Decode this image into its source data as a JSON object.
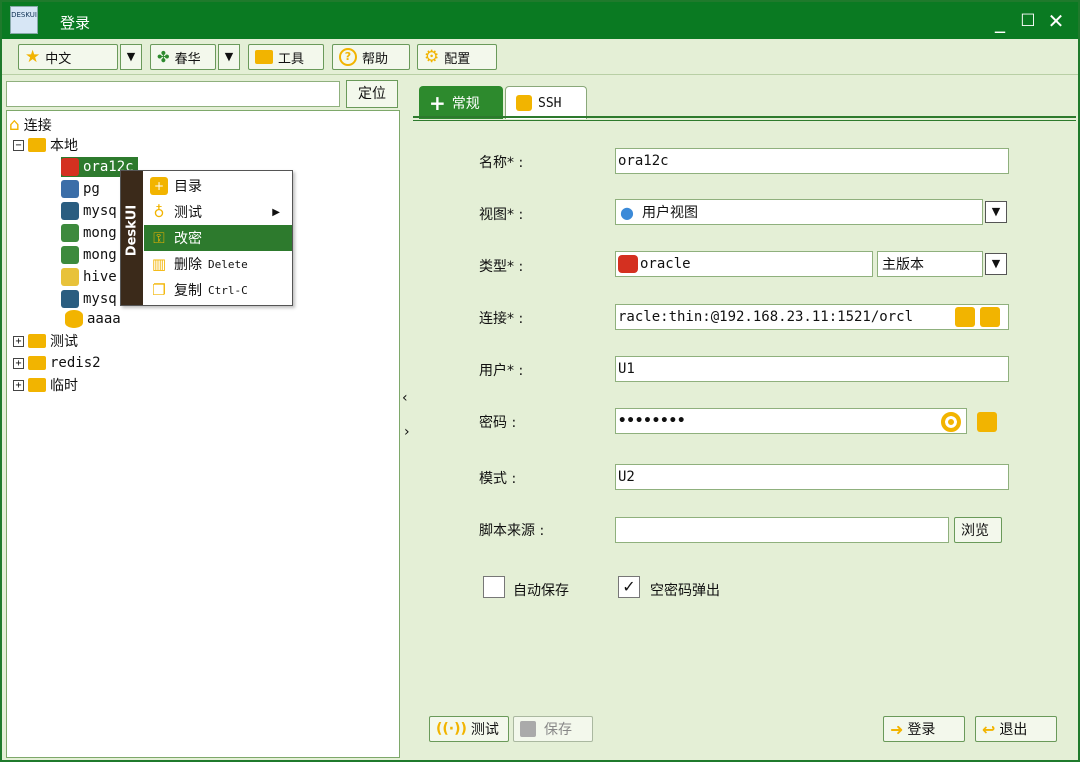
{
  "window": {
    "title": "登录",
    "logo_text": "DESKUI"
  },
  "toolbar": {
    "language": "中文",
    "theme": "春华",
    "tools": "工具",
    "help": "帮助",
    "config": "配置"
  },
  "left": {
    "search_placeholder": "",
    "locate": "定位",
    "tree": {
      "root": "连接",
      "local": "本地",
      "items": [
        "ora12c",
        "pg",
        "mysq",
        "mong",
        "mong",
        "hive",
        "mysq",
        "aaaa"
      ],
      "groups": [
        "测试",
        "redis2",
        "临时"
      ]
    },
    "context_menu": {
      "brand": "DeskUI",
      "items": [
        {
          "label": "目录",
          "shortcut": ""
        },
        {
          "label": "测试",
          "shortcut": ""
        },
        {
          "label": "改密",
          "shortcut": ""
        },
        {
          "label": "删除",
          "shortcut": "Delete"
        },
        {
          "label": "复制",
          "shortcut": "Ctrl-C"
        }
      ]
    }
  },
  "tabs": {
    "general": "常规",
    "ssh": "SSH"
  },
  "form": {
    "name_label": "名称* :",
    "name_value": "ora12c",
    "view_label": "视图* :",
    "view_value": "用户视图",
    "type_label": "类型* :",
    "type_value": "oracle",
    "version_value": "主版本",
    "conn_label": "连接* :",
    "conn_value": "racle:thin:@192.168.23.11:1521/orcl",
    "user_label": "用户* :",
    "user_value": "U1",
    "pwd_label": "密码 :",
    "pwd_value": "••••••••",
    "schema_label": "模式 :",
    "schema_value": "U2",
    "script_label": "脚本来源 :",
    "script_value": "",
    "browse": "浏览",
    "autosave_label": "自动保存",
    "autosave_checked": false,
    "emptypwd_label": "空密码弹出",
    "emptypwd_checked": true
  },
  "actions": {
    "test": "测试",
    "save": "保存",
    "login": "登录",
    "exit": "退出"
  },
  "colors": {
    "accent": "#2d8a2d",
    "title_bar": "#0a7a22",
    "panel_bg": "#e4efd6"
  }
}
